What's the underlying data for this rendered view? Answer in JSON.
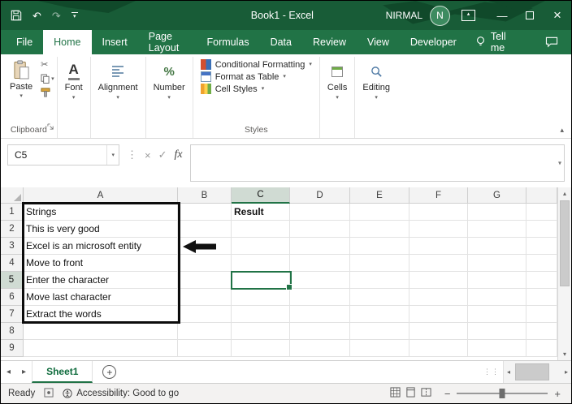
{
  "colors": {
    "accent": "#217346",
    "titlebar_green": "#185C37",
    "tabbar_green": "#217346"
  },
  "titlebar": {
    "title": "Book1 - Excel",
    "user": "NIRMAL",
    "avatar_initial": "N"
  },
  "tabs": {
    "file": "File",
    "items": [
      "Home",
      "Insert",
      "Page Layout",
      "Formulas",
      "Data",
      "Review",
      "View",
      "Developer"
    ],
    "active": "Home",
    "tell_me": "Tell me"
  },
  "ribbon": {
    "clipboard": {
      "group": "Clipboard",
      "paste": "Paste"
    },
    "font": {
      "group": "Font",
      "icon_letter": "A"
    },
    "alignment": {
      "group": "Alignment"
    },
    "number": {
      "group": "Number",
      "icon": "%"
    },
    "styles": {
      "group": "Styles",
      "items": [
        "Conditional Formatting",
        "Format as Table",
        "Cell Styles"
      ]
    },
    "cells": {
      "group": "Cells"
    },
    "editing": {
      "group": "Editing"
    }
  },
  "formula_bar": {
    "name_box": "C5",
    "cancel": "×",
    "enter": "✓",
    "fx": "fx",
    "formula": ""
  },
  "sheet": {
    "columns": [
      "A",
      "B",
      "C",
      "D",
      "E",
      "F",
      "G"
    ],
    "rows": [
      "1",
      "2",
      "3",
      "4",
      "5",
      "6",
      "7",
      "8",
      "9"
    ],
    "cells": {
      "A1": "Strings",
      "A2": "This is very good",
      "A3": "Excel is an microsoft entity",
      "A4": "Move to front",
      "A5": "Enter the character",
      "A6": "Move last character",
      "A7": "Extract the words",
      "C1": "Result"
    },
    "bold_cells": [
      "C1"
    ],
    "active_cell": "C5",
    "selected_column": "C",
    "selected_row": "5"
  },
  "sheet_tabs": {
    "tabs": [
      "Sheet1"
    ],
    "active": "Sheet1"
  },
  "status_bar": {
    "mode": "Ready",
    "accessibility": "Accessibility: Good to go"
  }
}
